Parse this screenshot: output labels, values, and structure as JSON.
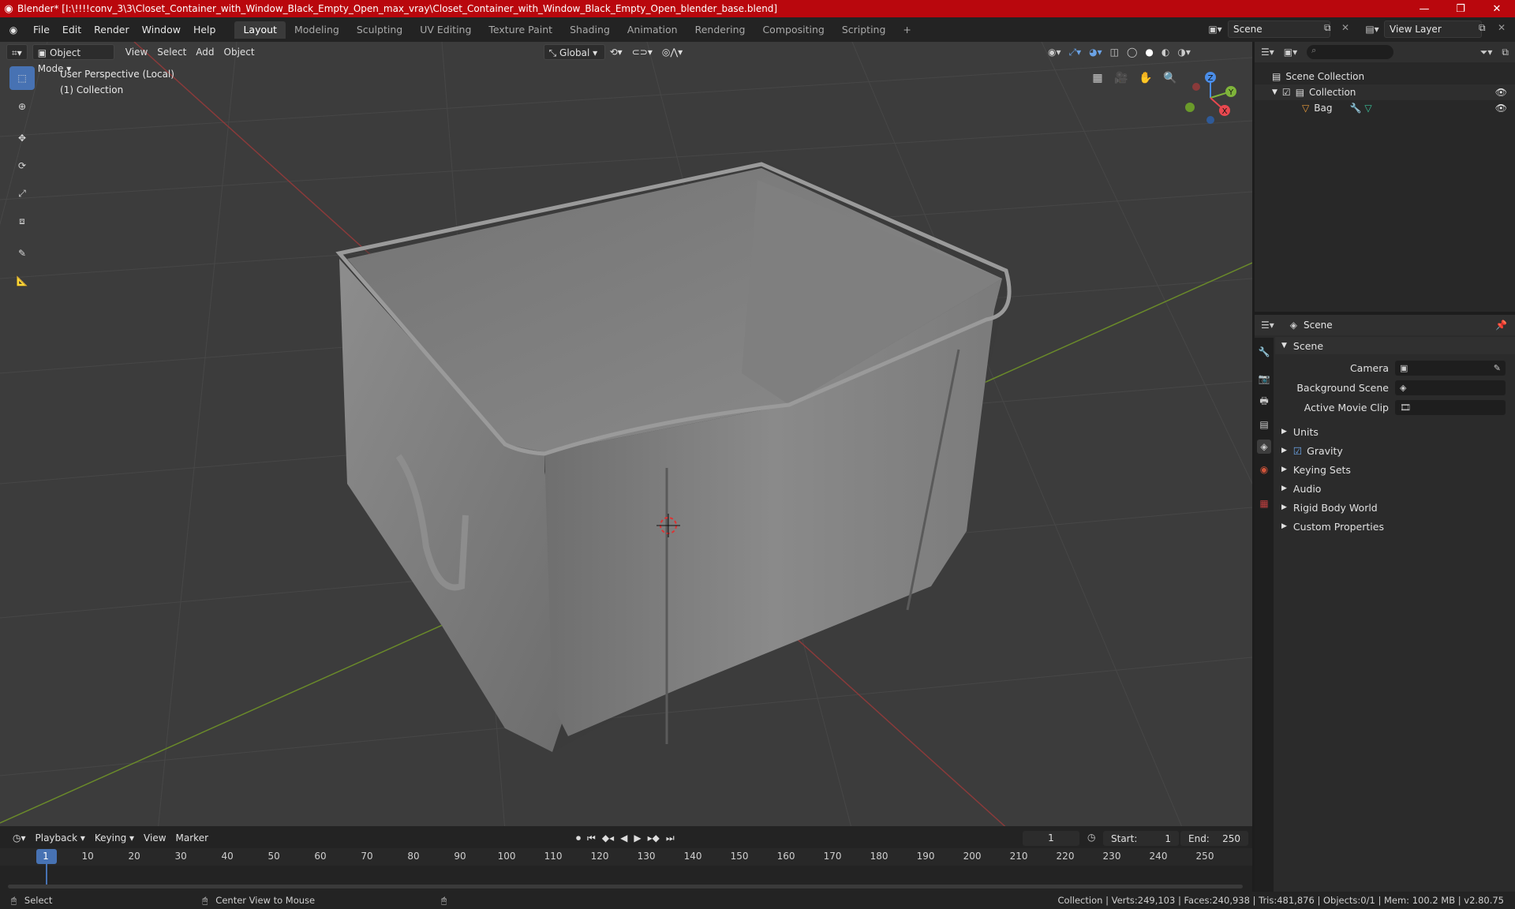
{
  "window": {
    "title": "Blender* [I:\\!!!!conv_3\\3\\Closet_Container_with_Window_Black_Empty_Open_max_vray\\Closet_Container_with_Window_Black_Empty_Open_blender_base.blend]",
    "accent": "#b9070d"
  },
  "menu": [
    "File",
    "Edit",
    "Render",
    "Window",
    "Help"
  ],
  "workspaces": [
    "Layout",
    "Modeling",
    "Sculpting",
    "UV Editing",
    "Texture Paint",
    "Shading",
    "Animation",
    "Rendering",
    "Compositing",
    "Scripting"
  ],
  "active_workspace": "Layout",
  "scene_name": "Scene",
  "view_layer": "View Layer",
  "viewport": {
    "mode": "Object Mode",
    "menus": [
      "View",
      "Select",
      "Add",
      "Object"
    ],
    "orientation": "Global",
    "info_line1": "User Perspective (Local)",
    "info_line2": "(1) Collection",
    "gizmo": {
      "x": "X",
      "y": "Y",
      "z": "Z"
    }
  },
  "outliner": {
    "root": "Scene Collection",
    "collection": "Collection",
    "object": "Bag"
  },
  "properties": {
    "header": "Scene",
    "panel": "Scene",
    "camera_label": "Camera",
    "background_label": "Background Scene",
    "movieclip_label": "Active Movie Clip",
    "sections": [
      "Units",
      "Gravity",
      "Keying Sets",
      "Audio",
      "Rigid Body World",
      "Custom Properties"
    ]
  },
  "timeline": {
    "menus": [
      "Playback",
      "Keying",
      "View",
      "Marker"
    ],
    "current_frame": "1",
    "start_label": "Start:",
    "start": "1",
    "end_label": "End:",
    "end": "250",
    "ticks": [
      "1",
      "10",
      "20",
      "30",
      "40",
      "50",
      "60",
      "70",
      "80",
      "90",
      "100",
      "110",
      "120",
      "130",
      "140",
      "150",
      "160",
      "170",
      "180",
      "190",
      "200",
      "210",
      "220",
      "230",
      "240",
      "250"
    ]
  },
  "status": {
    "left": "Select",
    "middle": "Center View to Mouse",
    "right": "Collection | Verts:249,103 | Faces:240,938 | Tris:481,876 | Objects:0/1 | Mem: 100.2 MB | v2.80.75"
  }
}
